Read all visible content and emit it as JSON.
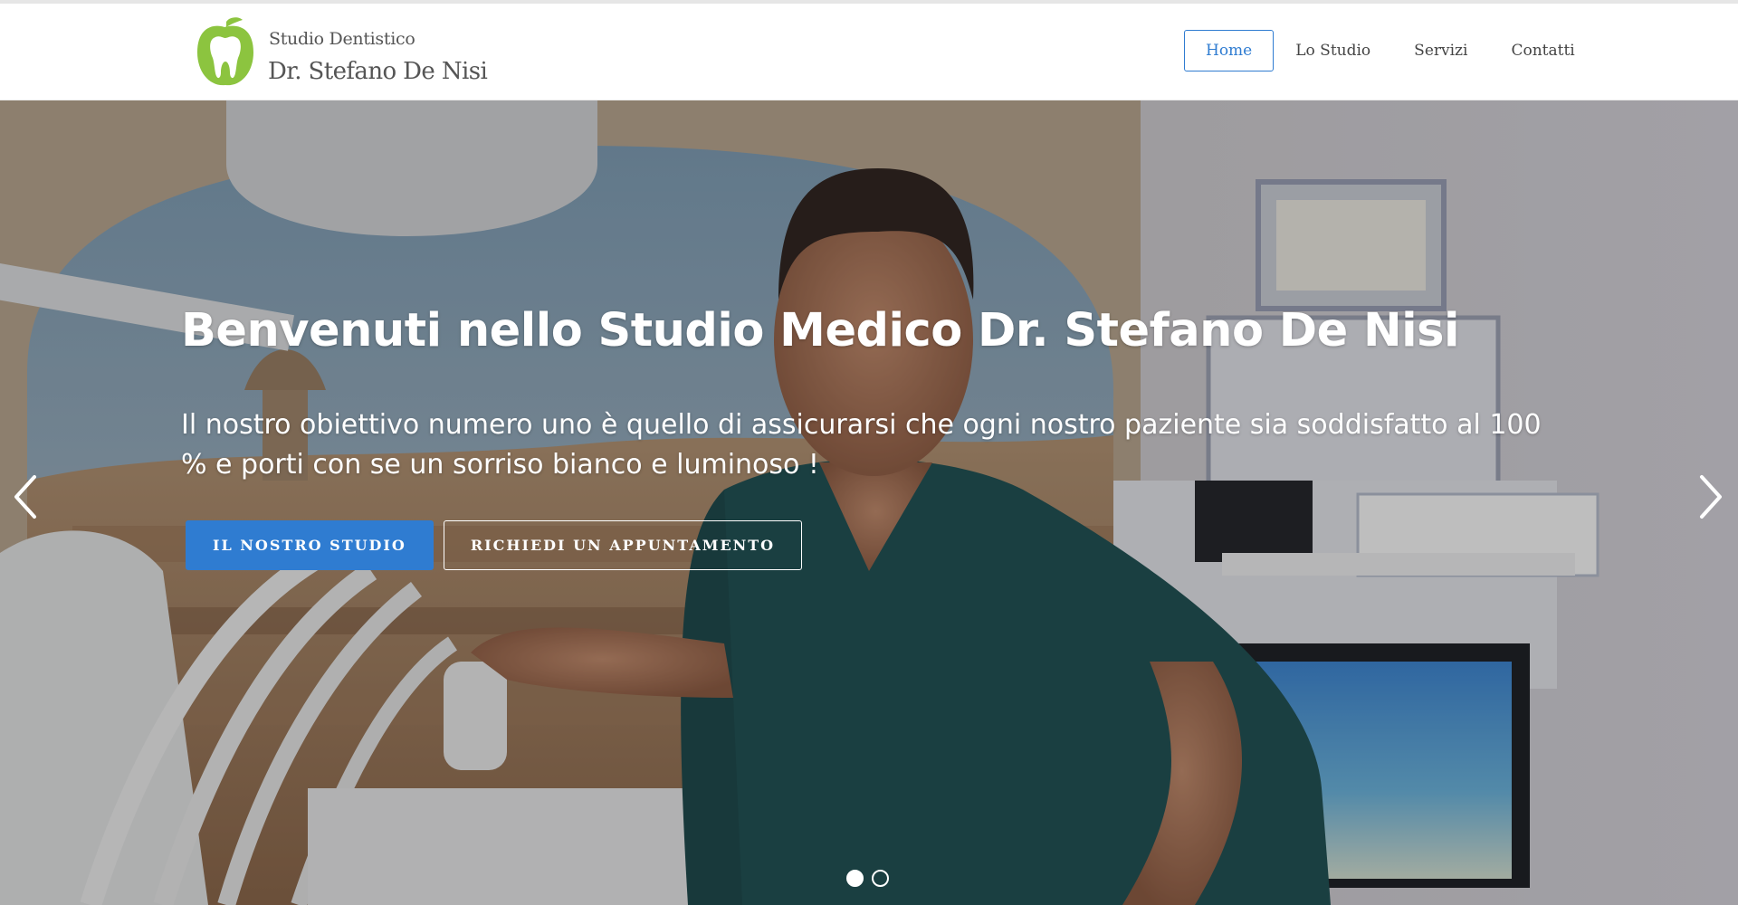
{
  "brand": {
    "subtitle": "Studio Dentistico",
    "name": "Dr. Stefano De Nisi",
    "logo_icon": "apple-tooth-icon",
    "logo_color": "#8cc43f"
  },
  "nav": {
    "items": [
      {
        "label": "Home",
        "active": true
      },
      {
        "label": "Lo Studio",
        "active": false
      },
      {
        "label": "Servizi",
        "active": false
      },
      {
        "label": "Contatti",
        "active": false
      }
    ]
  },
  "hero": {
    "title": "Benvenuti nello Studio Medico Dr. Stefano De Nisi",
    "text": "Il nostro obiettivo numero uno è quello di assicurarsi che ogni nostro paziente sia soddisfatto al 100 % e porti con se un sorriso bianco e luminoso !",
    "primary_button": "IL NOSTRO STUDIO",
    "secondary_button": "RICHIEDI UN APPUNTAMENTO",
    "slides_count": 2,
    "active_slide": 1,
    "prev_icon": "chevron-left-icon",
    "next_icon": "chevron-right-icon"
  },
  "colors": {
    "accent": "#2f7cd1",
    "brand_green": "#8cc43f"
  }
}
